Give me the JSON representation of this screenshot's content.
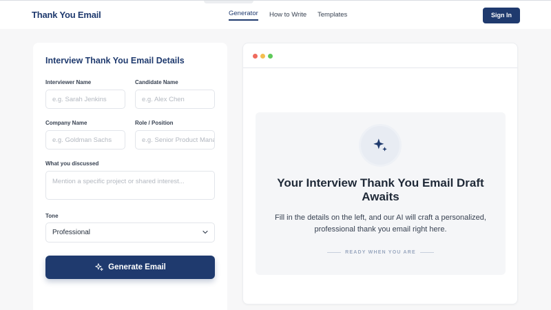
{
  "header": {
    "brand": "Thank You Email",
    "nav": [
      {
        "label": "Generator",
        "active": true
      },
      {
        "label": "How to Write",
        "active": false
      },
      {
        "label": "Templates",
        "active": false
      }
    ],
    "signin_label": "Sign In"
  },
  "form": {
    "title": "Interview Thank You Email Details",
    "interviewer": {
      "label": "Interviewer Name",
      "placeholder": "e.g. Sarah Jenkins"
    },
    "candidate": {
      "label": "Candidate Name",
      "placeholder": "e.g. Alex Chen"
    },
    "company": {
      "label": "Company Name",
      "placeholder": "e.g. Goldman Sachs"
    },
    "role": {
      "label": "Role / Position",
      "placeholder": "e.g. Senior Product Manager"
    },
    "discussed": {
      "label": "What you discussed",
      "placeholder": "Mention a specific project or shared interest..."
    },
    "tone": {
      "label": "Tone",
      "value": "Professional"
    },
    "generate_label": "Generate Email"
  },
  "preview": {
    "headline": "Your Interview Thank You Email Draft Awaits",
    "description": "Fill in the details on the left, and our AI will craft a personalized, professional thank you email right here.",
    "status": "READY WHEN YOU ARE",
    "window_dots": [
      "#ef6b5e",
      "#f4be4f",
      "#5ec95a"
    ]
  },
  "colors": {
    "brand": "#1f3a6e",
    "background": "#f7f7f8"
  },
  "icons": {
    "generate": "sparkles-icon",
    "badge": "sparkles-icon",
    "select": "chevron-down-icon"
  }
}
